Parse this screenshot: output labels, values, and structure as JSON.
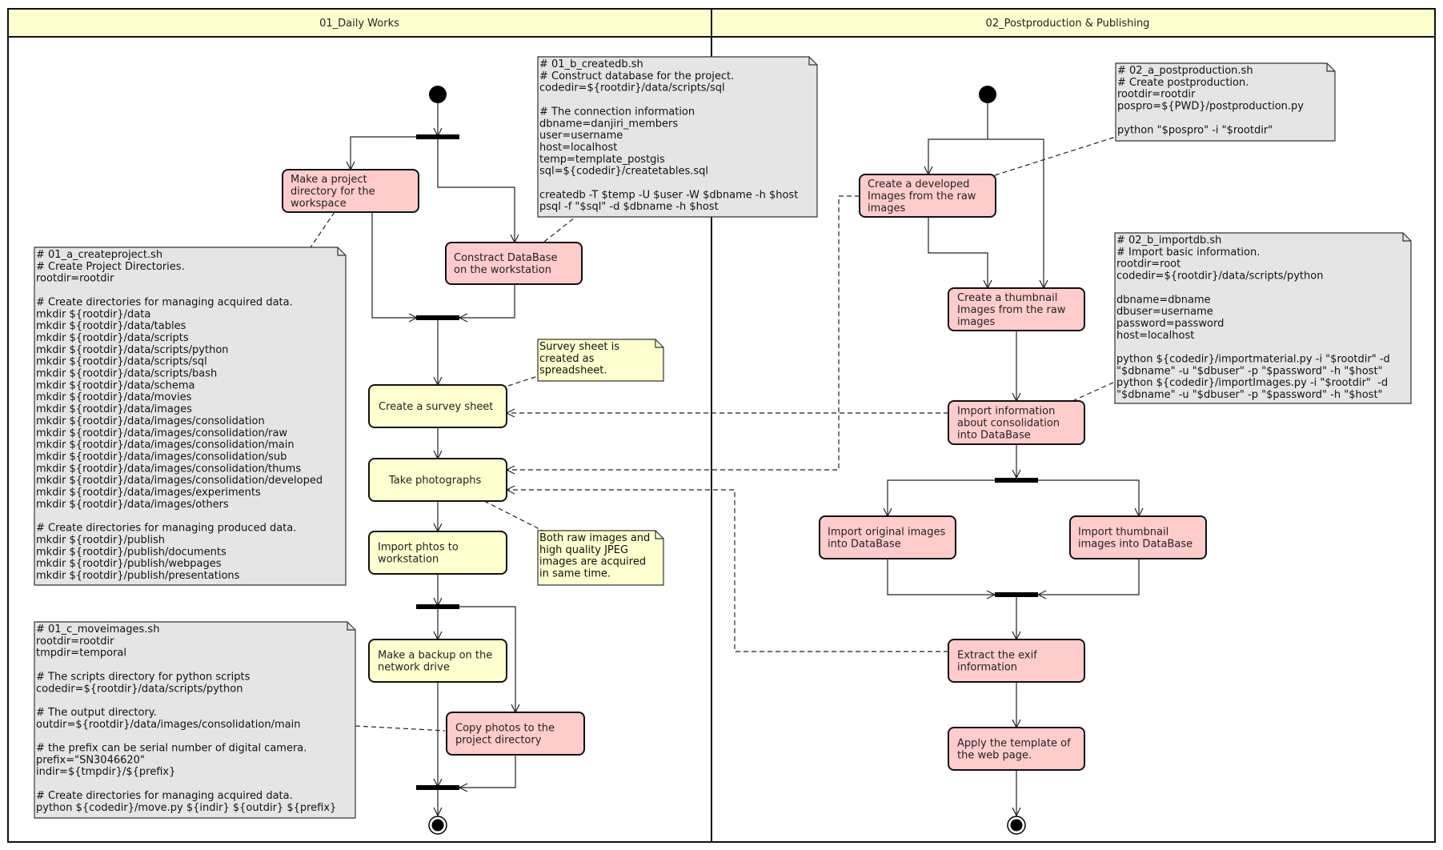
{
  "colors": {
    "lane_header": "#fefece",
    "activity_pink": "#ffcccc",
    "activity_yellow": "#fefece",
    "note_gray": "#e5e5e5",
    "note_yellow": "#fefece",
    "line": "#222222"
  },
  "lanes": [
    {
      "id": "lane1",
      "title": "01_Daily Works"
    },
    {
      "id": "lane2",
      "title": "02_Postproduction & Publishing"
    }
  ],
  "activities": {
    "make_project_dir": {
      "lines": [
        "Make a project",
        "directory for the",
        "workspace"
      ],
      "style": "pink"
    },
    "construct_db": {
      "lines": [
        "Constract DataBase",
        "on the workstation"
      ],
      "style": "pink"
    },
    "create_survey": {
      "lines": [
        "Create a survey sheet"
      ],
      "style": "yellow"
    },
    "take_photos": {
      "lines": [
        "Take photographs"
      ],
      "style": "yellow"
    },
    "import_photos": {
      "lines": [
        "Import phtos to",
        "workstation"
      ],
      "style": "yellow"
    },
    "backup": {
      "lines": [
        "Make a backup on the",
        "network drive"
      ],
      "style": "yellow"
    },
    "copy_photos": {
      "lines": [
        "Copy photos to the",
        "project directory"
      ],
      "style": "pink"
    },
    "create_developed": {
      "lines": [
        "Create a developed",
        "Images from the raw",
        "images"
      ],
      "style": "pink"
    },
    "create_thumbnail": {
      "lines": [
        "Create a thumbnail",
        "Images from the raw",
        "images"
      ],
      "style": "pink"
    },
    "import_info": {
      "lines": [
        "Import information",
        "about consolidation",
        "into DataBase"
      ],
      "style": "pink"
    },
    "import_original": {
      "lines": [
        "Import original images",
        "into DataBase"
      ],
      "style": "pink"
    },
    "import_thumbnail": {
      "lines": [
        "Import thumbnail",
        "images into DataBase"
      ],
      "style": "pink"
    },
    "extract_exif": {
      "lines": [
        "Extract the exif",
        "information"
      ],
      "style": "pink"
    },
    "apply_template": {
      "lines": [
        "Apply the template of",
        "the web page."
      ],
      "style": "pink"
    }
  },
  "notes": {
    "createproject": {
      "style": "gray",
      "lines": [
        "# 01_a_createproject.sh",
        "# Create Project Directories.",
        "rootdir=rootdir",
        "",
        "# Create directories for managing acquired data.",
        "mkdir ${rootdir}/data",
        "mkdir ${rootdir}/data/tables",
        "mkdir ${rootdir}/data/scripts",
        "mkdir ${rootdir}/data/scripts/python",
        "mkdir ${rootdir}/data/scripts/sql",
        "mkdir ${rootdir}/data/scripts/bash",
        "mkdir ${rootdir}/data/schema",
        "mkdir ${rootdir}/data/movies",
        "mkdir ${rootdir}/data/images",
        "mkdir ${rootdir}/data/images/consolidation",
        "mkdir ${rootdir}/data/images/consolidation/raw",
        "mkdir ${rootdir}/data/images/consolidation/main",
        "mkdir ${rootdir}/data/images/consolidation/sub",
        "mkdir ${rootdir}/data/images/consolidation/thums",
        "mkdir ${rootdir}/data/images/consolidation/developed",
        "mkdir ${rootdir}/data/images/experiments",
        "mkdir ${rootdir}/data/images/others",
        "",
        "# Create directories for managing produced data.",
        "mkdir ${rootdir}/publish",
        "mkdir ${rootdir}/publish/documents",
        "mkdir ${rootdir}/publish/webpages",
        "mkdir ${rootdir}/publish/presentations"
      ]
    },
    "createdb": {
      "style": "gray",
      "lines": [
        "# 01_b_createdb.sh",
        "# Construct database for the project.",
        "codedir=${rootdir}/data/scripts/sql",
        "",
        "# The connection information",
        "dbname=danjiri_members",
        "user=username",
        "host=localhost",
        "temp=template_postgis",
        "sql=${codedir}/createtables.sql",
        "",
        "createdb -T $temp -U $user -W $dbname -h $host",
        "psql -f \"$sql\" -d $dbname -h $host"
      ]
    },
    "survey": {
      "style": "yellow",
      "lines": [
        "Survey sheet is",
        "created as",
        "spreadsheet."
      ]
    },
    "photos": {
      "style": "yellow",
      "lines": [
        "Both raw images and",
        "high quality JPEG",
        "images are acquired",
        "in same time."
      ]
    },
    "moveimages": {
      "style": "gray",
      "lines": [
        "# 01_c_moveimages.sh",
        "rootdir=rootdir",
        "tmpdir=temporal",
        "",
        "# The scripts directory for python scripts",
        "codedir=${rootdir}/data/scripts/python",
        "",
        "# The output directory.",
        "outdir=${rootdir}/data/images/consolidation/main",
        "",
        "# the prefix can be serial number of digital camera.",
        "prefix=\"SN3046620\"",
        "indir=${tmpdir}/${prefix}",
        "",
        "# Create directories for managing acquired data.",
        "python ${codedir}/move.py ${indir} ${outdir} ${prefix}"
      ]
    },
    "postproduction": {
      "style": "gray",
      "lines": [
        "# 02_a_postproduction.sh",
        "# Create postproduction.",
        "rootdir=rootdir",
        "pospro=${PWD}/postproduction.py",
        "",
        "python \"$pospro\" -i \"$rootdir\""
      ]
    },
    "importdb": {
      "style": "gray",
      "lines": [
        "# 02_b_importdb.sh",
        "# Import basic information.",
        "rootdir=root",
        "codedir=${rootdir}/data/scripts/python",
        "",
        "dbname=dbname",
        "dbuser=username",
        "password=password",
        "host=localhost",
        "",
        "python ${codedir}/importmaterial.py -i \"$rootdir\" -d",
        "\"$dbname\" -u \"$dbuser\" -p \"$password\" -h \"$host\"",
        "python ${codedir}/importImages.py -i \"$rootdir\"  -d",
        "\"$dbname\" -u \"$dbuser\" -p \"$password\" -h \"$host\""
      ]
    }
  }
}
